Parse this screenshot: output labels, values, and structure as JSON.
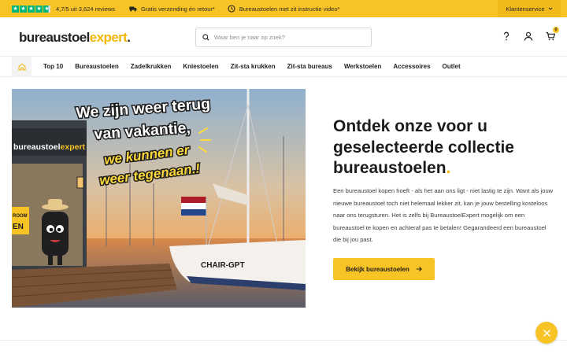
{
  "topbar": {
    "rating_text": "4,7/5 uit 3,624 reviews",
    "usp_shipping": "Gratis verzending én retour*",
    "usp_video": "Bureaustoelen met zit instructie video*",
    "customer_service": "Klantenservice"
  },
  "header": {
    "logo_main": "bureaustoel",
    "logo_accent": "expert",
    "logo_dot": ".",
    "search_placeholder": "Waar ben je naar op zoek?",
    "cart_count": "0"
  },
  "nav": {
    "items": [
      "Top 10",
      "Bureaustoelen",
      "Zadelkrukken",
      "Kniestoelen",
      "Zit-sta krukken",
      "Zit-sta bureaus",
      "Werkstoelen",
      "Accessoires",
      "Outlet"
    ]
  },
  "hero": {
    "title": "Ontdek onze voor u geselecteerde collectie bureaustoelen",
    "title_dot": ".",
    "body": "Een bureaustoel kopen hoeft - als het aan ons ligt - niet lastig te zijn. Want als jouw nieuwe bureaustoel toch niet helemaal lekker zit, kan je jouw bestelling kosteloos naar ons terugsturen. Het is zelfs bij BureaustoelExpert mogelijk om een bureaustoel te kopen en achteraf pas te betalen! Gegarandeerd een bureaustoel die bij jou past.",
    "cta_label": "Bekijk bureaustoelen",
    "image": {
      "headline_line1": "We zijn weer terug",
      "headline_line2": "van vakantie,",
      "subline_line1": "we kunnen er",
      "subline_line2": "weer tegenaan.!",
      "store_sign_main": "bureaustoel",
      "store_sign_accent": "expert",
      "boat_name": "CHAIR-GPT",
      "showroom_fragment_1": "ROOM",
      "showroom_fragment_2": "EN"
    }
  },
  "colors": {
    "brand_yellow": "#f7c325",
    "trustpilot_green": "#00b67a"
  }
}
